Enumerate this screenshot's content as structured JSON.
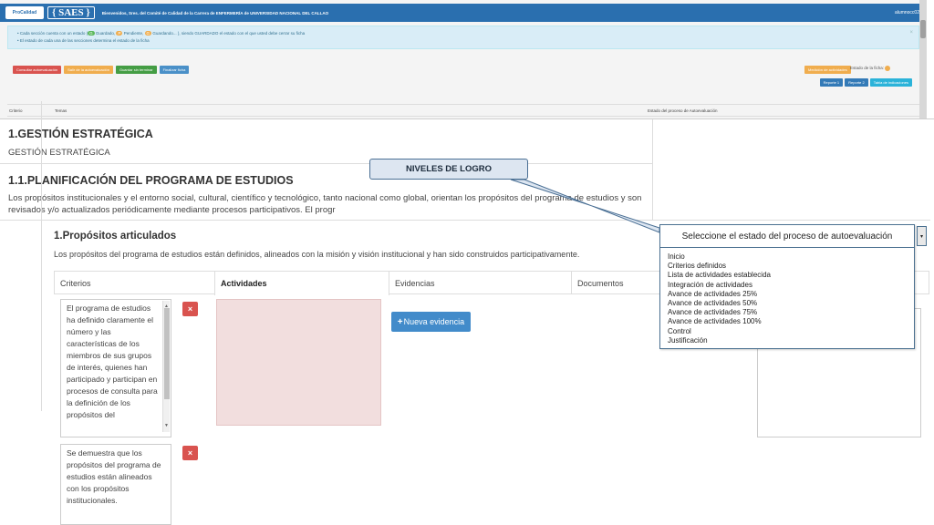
{
  "navbar": {
    "logo_text": "ProCalidad",
    "app_name": "{ SAES }",
    "welcome": "Bienvenidos, Sres. del Comité de Calidad de la Carrera de ENFERMERÍA de UNIVERSIDAD NACIONAL DEL CALLAO",
    "user": "alumnocc02"
  },
  "alert": {
    "line1_prefix": "Cada sección cuenta con un estado (",
    "line1_green": "G",
    "line1_mid": "Guardado,",
    "line1_orange": "P",
    "line1_mid2": "Pendiente,",
    "line1_orange2": "G",
    "line1_suffix": "Guardando... ), siendo GUARDADO el estado con el que usted debe cerrar su ficha",
    "line2": "El estado de cada una de las secciones determina el estado de la ficha"
  },
  "toolbar": {
    "btn1": "Consultar autoevaluación",
    "btn2": "Salir de la autoevaluación",
    "btn3": "Guardar sin terminar",
    "btn4": "Finalizar ficha",
    "tool_orange": "Medición de actividades",
    "ficha_status": "Estado de la ficha:",
    "report1": "Reporte 1",
    "report2": "Reporte 2",
    "report3": "Tabla de indicaciones"
  },
  "mini_header": {
    "col1": "Criterio",
    "col2": "Temas",
    "col3": "Estado del proceso de Autoevaluación"
  },
  "main": {
    "section_title": "1.GESTIÓN ESTRATÉGICA",
    "section_sub": "GESTIÓN ESTRATÉGICA",
    "subsection_title": "1.1.PLANIFICACIÓN DEL PROGRAMA DE ESTUDIOS",
    "subsection_text": "Los propósitos institucionales y el entorno social, cultural, científico y tecnológico, tanto nacional como global, orientan los propósitos del programa de estudios y son revisados y/o actualizados periódicamente mediante procesos participativos. El progr",
    "standard_title": "1.Propósitos articulados",
    "standard_text": "Los propósitos del programa de estudios están definidos, alineados con la misión y visión institucional y han sido construidos participativamente."
  },
  "table": {
    "col_criterios": "Criterios",
    "col_actividades": "Actividades",
    "col_evidencias": "Evidencias",
    "col_documentos": "Documentos",
    "criterio1": "El programa de estudios ha definido claramente el número y las características de los miembros de sus grupos de interés, quienes han participado y participan en procesos de consulta para la definición de los propósitos del",
    "criterio2": "Se demuestra que los propósitos del programa de estudios están alineados con los propósitos institucionales.",
    "delete_icon": "×",
    "new_evidence": "Nueva evidencia",
    "new_evidence_icon": "+"
  },
  "dropdown": {
    "selected": "Seleccione el estado del proceso de autoevaluación",
    "options": [
      "Inicio",
      "Criterios definidos",
      "Lista de actividades establecida",
      "Integración de actividades",
      "Avance de actividades 25%",
      "Avance de actividades 50%",
      "Avance de actividades 75%",
      "Avance de actividades 100%",
      "Control",
      "Justificación"
    ],
    "arrow_icon": "▾"
  },
  "callout": {
    "label": "NIVELES DE LOGRO"
  }
}
